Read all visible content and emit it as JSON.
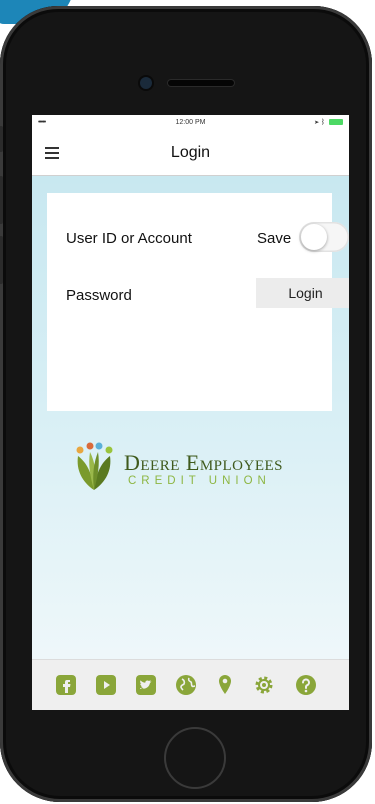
{
  "status_bar": {
    "carrier": "•••••",
    "time": "12:00 PM"
  },
  "nav": {
    "title": "Login"
  },
  "login_form": {
    "user_label": "User ID or Account",
    "save_label": "Save",
    "save_toggle_on": false,
    "password_label": "Password",
    "login_button": "Login"
  },
  "logo": {
    "name": "Deere Employees",
    "subtitle": "CREDIT UNION"
  },
  "tab_bar": {
    "icons": [
      "facebook-icon",
      "youtube-icon",
      "twitter-icon",
      "globe-icon",
      "location-pin-icon",
      "gear-icon",
      "help-icon"
    ]
  },
  "colors": {
    "accent_green": "#8aa63a",
    "brand_dark_green": "#3f5a1d",
    "brand_light_green": "#8db642",
    "screen_gradient_top": "#c4e6ef",
    "badge_blue": "#1d86b8"
  }
}
